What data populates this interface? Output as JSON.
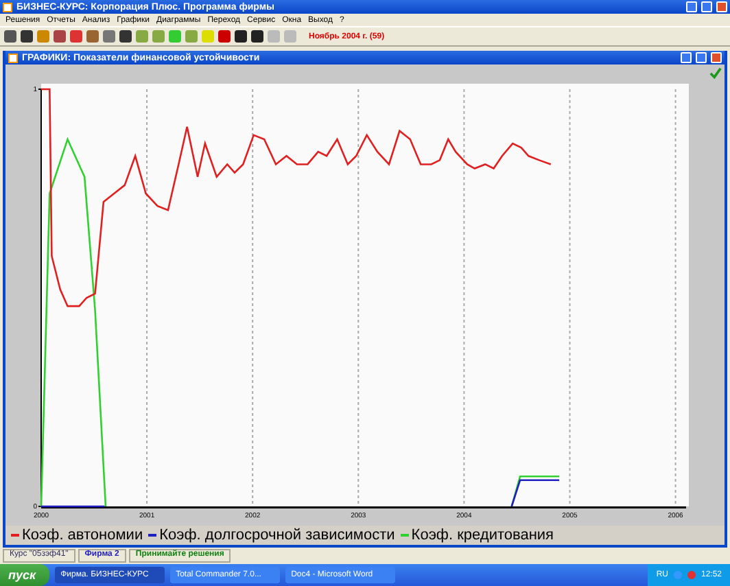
{
  "window": {
    "title": "БИЗНЕС-КУРС: Корпорация Плюс. Программа фирмы"
  },
  "menu": [
    "Решения",
    "Отчеты",
    "Анализ",
    "Графики",
    "Диаграммы",
    "Переход",
    "Сервис",
    "Окна",
    "Выход",
    "?"
  ],
  "toolbar": {
    "period": "Ноябрь 2004 г. (59)"
  },
  "chart_window": {
    "title": "ГРАФИКИ: Показатели финансовой устойчивости",
    "chart_data": {
      "type": "line",
      "xlim": [
        2000,
        2006.1
      ],
      "ylim": [
        0,
        1
      ],
      "xticks": [
        2000,
        2001,
        2002,
        2003,
        2004,
        2005,
        2006
      ],
      "yticks": [
        0,
        1
      ],
      "grid": true,
      "series": [
        {
          "name": "Коэф. автономии",
          "color": "#e02020",
          "x": [
            2000,
            2000.08,
            2000.1,
            2000.18,
            2000.25,
            2000.36,
            2000.43,
            2000.51,
            2000.59,
            2000.69,
            2000.79,
            2000.89,
            2000.99,
            2001.1,
            2001.2,
            2001.3,
            2001.38,
            2001.48,
            2001.55,
            2001.66,
            2001.76,
            2001.83,
            2001.91,
            2002.01,
            2002.11,
            2002.22,
            2002.32,
            2002.42,
            2002.52,
            2002.62,
            2002.7,
            2002.8,
            2002.9,
            2002.98,
            2003.08,
            2003.18,
            2003.29,
            2003.39,
            2003.49,
            2003.59,
            2003.69,
            2003.77,
            2003.85,
            2003.92,
            2004.03,
            2004.1,
            2004.2,
            2004.28,
            2004.36,
            2004.46,
            2004.54,
            2004.61,
            2004.71,
            2004.82
          ],
          "values": [
            1,
            1,
            0.6,
            0.52,
            0.48,
            0.48,
            0.5,
            0.51,
            0.73,
            0.75,
            0.77,
            0.84,
            0.75,
            0.72,
            0.71,
            0.82,
            0.91,
            0.79,
            0.87,
            0.79,
            0.82,
            0.8,
            0.82,
            0.89,
            0.88,
            0.82,
            0.84,
            0.82,
            0.82,
            0.85,
            0.84,
            0.88,
            0.82,
            0.84,
            0.89,
            0.85,
            0.82,
            0.9,
            0.88,
            0.82,
            0.82,
            0.83,
            0.88,
            0.85,
            0.82,
            0.81,
            0.82,
            0.81,
            0.84,
            0.87,
            0.86,
            0.84,
            0.83,
            0.82
          ]
        },
        {
          "name": "Коэф. долгосрочной зависимости",
          "color": "#2020c0",
          "x": [
            2000,
            2000.6,
            2004.45,
            2004.53,
            2004.9
          ],
          "values": [
            0,
            0,
            0,
            0.063,
            0.063
          ]
        },
        {
          "name": "Коэф. кредитования",
          "color": "#30d030",
          "x": [
            2000,
            2000.08,
            2000.25,
            2000.41,
            2000.51,
            2000.61,
            2004.45,
            2004.53,
            2004.9
          ],
          "values": [
            0,
            0.75,
            0.88,
            0.79,
            0.47,
            0,
            0,
            0.072,
            0.072
          ]
        }
      ]
    }
  },
  "status_bar": [
    {
      "text": "Курс \"05зэф41\"",
      "kind": "plain"
    },
    {
      "text": "Фирма 2",
      "kind": "firm"
    },
    {
      "text": "Принимайте решения",
      "kind": "hint"
    }
  ],
  "taskbar": {
    "start": "пуск",
    "tasks": [
      {
        "label": "Фирма. БИЗНЕС-КУРС",
        "selected": true
      },
      {
        "label": "Total Commander 7.0...",
        "selected": false
      },
      {
        "label": "Doc4 - Microsoft Word",
        "selected": false
      }
    ],
    "language": "RU",
    "clock": "12:52"
  }
}
